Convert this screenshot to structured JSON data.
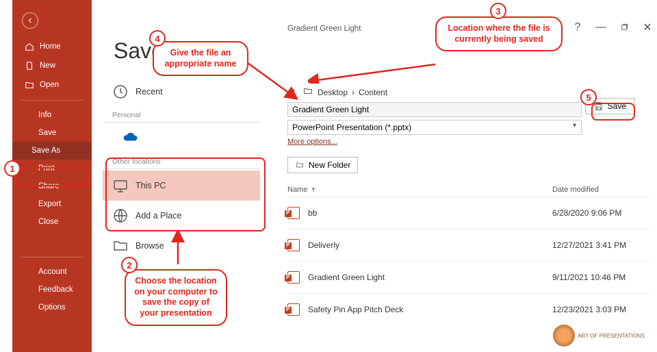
{
  "doc_title": "Gradient Green Light",
  "page_title": "Save As",
  "sidebar": {
    "nav_primary": [
      {
        "label": "Home",
        "icon": "home"
      },
      {
        "label": "New",
        "icon": "new"
      },
      {
        "label": "Open",
        "icon": "open"
      }
    ],
    "nav_secondary": [
      "Info",
      "Save",
      "Save As",
      "Print",
      "Share",
      "Export",
      "Close"
    ],
    "active_item": "Save As",
    "nav_bottom": [
      "Account",
      "Feedback",
      "Options"
    ]
  },
  "locations": {
    "recent_label": "Recent",
    "personal_header": "Personal",
    "other_header": "Other locations",
    "other": [
      {
        "label": "This PC",
        "selected": true
      },
      {
        "label": "Add a Place",
        "selected": false
      },
      {
        "label": "Browse",
        "selected": false
      }
    ]
  },
  "save_panel": {
    "path_parts": [
      "Desktop",
      "Content"
    ],
    "filename": "Gradient Green Light",
    "filetype": "PowerPoint Presentation (*.pptx)",
    "more_options": "More options...",
    "save_label": "Save",
    "new_folder_label": "New Folder",
    "columns": {
      "name": "Name",
      "date": "Date modified"
    },
    "files": [
      {
        "name": "bb",
        "date": "6/28/2020 9:06 PM"
      },
      {
        "name": "Deliverly",
        "date": "12/27/2021 3:41 PM"
      },
      {
        "name": "Gradient Green Light",
        "date": "9/11/2021 10:46 PM"
      },
      {
        "name": "Safety Pin App Pitch Deck",
        "date": "12/23/2021 3:03 PM"
      }
    ]
  },
  "annotations": {
    "a1": "1",
    "a2": "2",
    "a2_text": "Choose the location on your computer to save the copy of your presentation",
    "a3": "3",
    "a3_text": "Location where the file is currently being saved",
    "a4": "4",
    "a4_text": "Give the file an appropriate name",
    "a5": "5"
  },
  "logo_text": "ART OF PRESENTATIONS"
}
